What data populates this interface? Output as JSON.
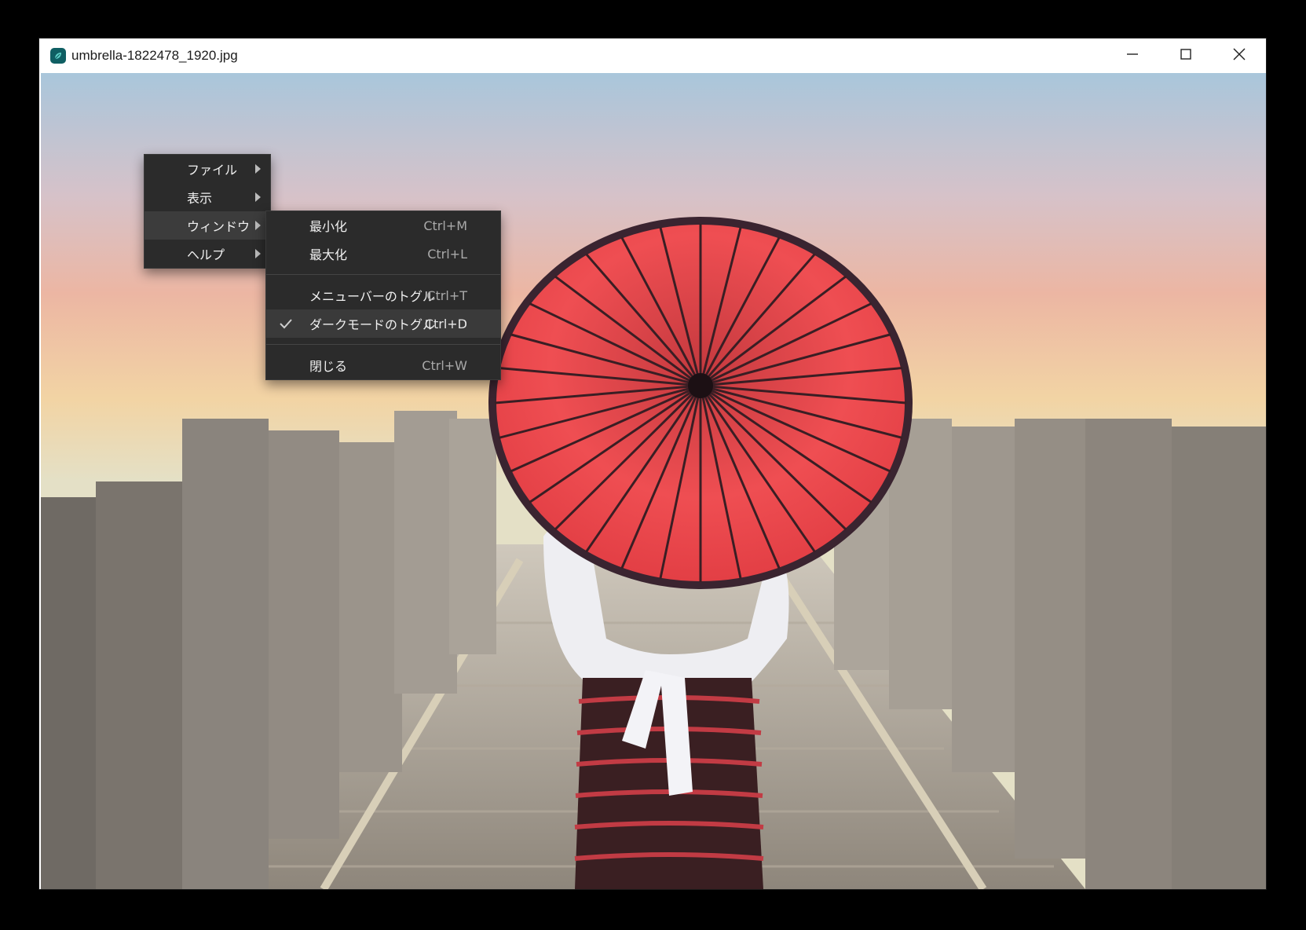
{
  "window": {
    "title": "umbrella-1822478_1920.jpg"
  },
  "titlebar_controls": {
    "minimize": "minimize-icon",
    "maximize": "maximize-icon",
    "close": "close-icon"
  },
  "menu": {
    "items": [
      {
        "label": "ファイル",
        "has_submenu": true
      },
      {
        "label": "表示",
        "has_submenu": true
      },
      {
        "label": "ウィンドウ",
        "has_submenu": true,
        "active": true
      },
      {
        "label": "ヘルプ",
        "has_submenu": true
      }
    ]
  },
  "window_submenu": {
    "items": [
      {
        "label": "最小化",
        "shortcut": "Ctrl+M"
      },
      {
        "label": "最大化",
        "shortcut": "Ctrl+L"
      },
      {
        "label": "メニューバーのトグル",
        "shortcut": "Ctrl+T"
      },
      {
        "label": "ダークモードのトグル",
        "shortcut": "Ctrl+D",
        "checked": true
      },
      {
        "label": "閉じる",
        "shortcut": "Ctrl+W"
      }
    ]
  },
  "colors": {
    "menu_bg": "#2b2b2b",
    "menu_active": "#3c3c3c",
    "umbrella_red": "#e8484c"
  }
}
